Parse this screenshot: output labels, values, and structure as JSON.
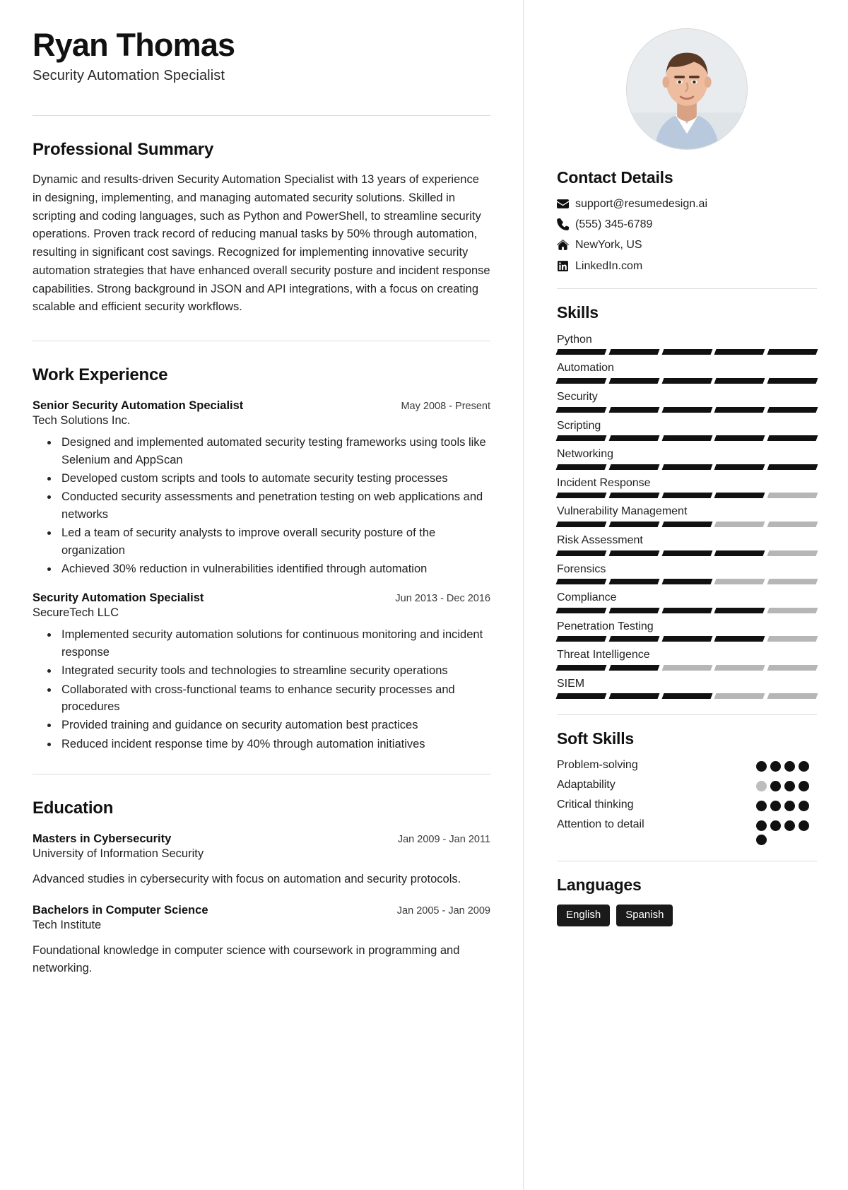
{
  "header": {
    "name": "Ryan Thomas",
    "job_title": "Security Automation Specialist"
  },
  "summary": {
    "heading": "Professional Summary",
    "text": "Dynamic and results-driven Security Automation Specialist with 13 years of experience in designing, implementing, and managing automated security solutions. Skilled in scripting and coding languages, such as Python and PowerShell, to streamline security operations. Proven track record of reducing manual tasks by 50% through automation, resulting in significant cost savings. Recognized for implementing innovative security automation strategies that have enhanced overall security posture and incident response capabilities. Strong background in JSON and API integrations, with a focus on creating scalable and efficient security workflows."
  },
  "experience": {
    "heading": "Work Experience",
    "items": [
      {
        "role": "Senior Security Automation Specialist",
        "date": "May 2008 - Present",
        "org": "Tech Solutions Inc.",
        "bullets": [
          "Designed and implemented automated security testing frameworks using tools like Selenium and AppScan",
          "Developed custom scripts and tools to automate security testing processes",
          "Conducted security assessments and penetration testing on web applications and networks",
          "Led a team of security analysts to improve overall security posture of the organization",
          "Achieved 30% reduction in vulnerabilities identified through automation"
        ]
      },
      {
        "role": "Security Automation Specialist",
        "date": "Jun 2013 - Dec 2016",
        "org": "SecureTech LLC",
        "bullets": [
          "Implemented security automation solutions for continuous monitoring and incident response",
          "Integrated security tools and technologies to streamline security operations",
          "Collaborated with cross-functional teams to enhance security processes and procedures",
          "Provided training and guidance on security automation best practices",
          "Reduced incident response time by 40% through automation initiatives"
        ]
      }
    ]
  },
  "education": {
    "heading": "Education",
    "items": [
      {
        "degree": "Masters in Cybersecurity",
        "date": "Jan 2009 - Jan 2011",
        "school": "University of Information Security",
        "description": "Advanced studies in cybersecurity with focus on automation and security protocols."
      },
      {
        "degree": "Bachelors in Computer Science",
        "date": "Jan 2005 - Jan 2009",
        "school": "Tech Institute",
        "description": "Foundational knowledge in computer science with coursework in programming and networking."
      }
    ]
  },
  "contact": {
    "heading": "Contact Details",
    "items": [
      {
        "icon": "envelope-icon",
        "value": "support@resumedesign.ai"
      },
      {
        "icon": "phone-icon",
        "value": "(555) 345-6789"
      },
      {
        "icon": "home-icon",
        "value": "NewYork, US"
      },
      {
        "icon": "linkedin-icon",
        "value": "LinkedIn.com"
      }
    ]
  },
  "skills": {
    "heading": "Skills",
    "max_level": 5,
    "items": [
      {
        "name": "Python",
        "level": 5
      },
      {
        "name": "Automation",
        "level": 5
      },
      {
        "name": "Security",
        "level": 5
      },
      {
        "name": "Scripting",
        "level": 5
      },
      {
        "name": "Networking",
        "level": 5
      },
      {
        "name": "Incident Response",
        "level": 4
      },
      {
        "name": "Vulnerability Management",
        "level": 3
      },
      {
        "name": "Risk Assessment",
        "level": 4
      },
      {
        "name": "Forensics",
        "level": 3
      },
      {
        "name": "Compliance",
        "level": 4
      },
      {
        "name": "Penetration Testing",
        "level": 4
      },
      {
        "name": "Threat Intelligence",
        "level": 2
      },
      {
        "name": "SIEM",
        "level": 3
      }
    ]
  },
  "soft_skills": {
    "heading": "Soft Skills",
    "max_level": 4,
    "items": [
      {
        "name": "Problem-solving",
        "level": 4
      },
      {
        "name": "Adaptability",
        "level": 3
      },
      {
        "name": "Critical thinking",
        "level": 4
      },
      {
        "name": "Attention to detail",
        "level": 5
      }
    ]
  },
  "languages": {
    "heading": "Languages",
    "items": [
      "English",
      "Spanish"
    ]
  },
  "colors": {
    "accent": "#111111",
    "muted": "#b6b6b6",
    "rule": "#dcdcdc"
  }
}
